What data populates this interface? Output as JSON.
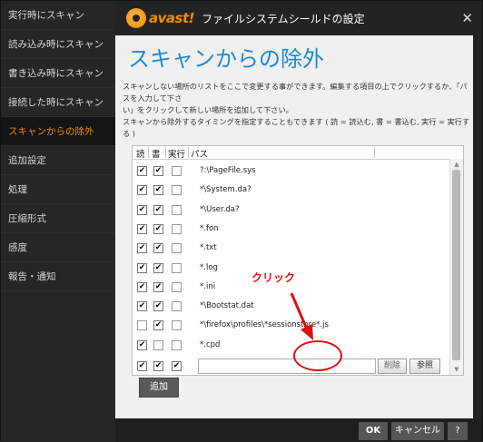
{
  "window": {
    "logo_text": "avast!",
    "title": "ファイルシステムシールドの設定",
    "close_glyph": "✕"
  },
  "sidebar": {
    "items": [
      {
        "label": "実行時にスキャン",
        "active": false
      },
      {
        "label": "読み込み時にスキャン",
        "active": false
      },
      {
        "label": "書き込み時にスキャン",
        "active": false
      },
      {
        "label": "接続した時にスキャン",
        "active": false
      },
      {
        "label": "スキャンからの除外",
        "active": true
      },
      {
        "label": "追加設定",
        "active": false
      },
      {
        "label": "処理",
        "active": false
      },
      {
        "label": "圧縮形式",
        "active": false
      },
      {
        "label": "感度",
        "active": false
      },
      {
        "label": "報告・通知",
        "active": false
      }
    ]
  },
  "main": {
    "heading": "スキャンからの除外",
    "description_line1": "スキャンしない場所のリストをここで変更する事ができます。編集する項目の上でクリックするか、「パスを入力して下さ",
    "description_line2": "い」をクリックして新しい場所を追加して下さい。",
    "description_line3": "スキャンから除外するタイミングを指定することもできます ( 読 = 読込む, 書 = 書込む, 実行 = 実行する )"
  },
  "table": {
    "headers": {
      "read": "読",
      "write": "書",
      "exec": "実行",
      "path": "パス"
    },
    "rows": [
      {
        "read": true,
        "write": true,
        "exec": false,
        "path": "?:\\PageFile.sys"
      },
      {
        "read": true,
        "write": true,
        "exec": false,
        "path": "*\\System.da?"
      },
      {
        "read": true,
        "write": true,
        "exec": false,
        "path": "*\\User.da?"
      },
      {
        "read": true,
        "write": true,
        "exec": false,
        "path": "*.fon"
      },
      {
        "read": true,
        "write": true,
        "exec": false,
        "path": "*.txt"
      },
      {
        "read": true,
        "write": true,
        "exec": false,
        "path": "*.log"
      },
      {
        "read": true,
        "write": true,
        "exec": false,
        "path": "*.ini"
      },
      {
        "read": true,
        "write": true,
        "exec": false,
        "path": "*\\Bootstat.dat"
      },
      {
        "read": false,
        "write": true,
        "exec": false,
        "path": "*\\firefox\\profiles\\*sessionstore*.js"
      },
      {
        "read": true,
        "write": false,
        "exec": false,
        "path": "*.cpd"
      }
    ],
    "new_row": {
      "read": true,
      "write": true,
      "exec": true,
      "path_value": ""
    },
    "delete_label": "削除",
    "browse_label": "参照",
    "check_glyph": "✔"
  },
  "annotation": {
    "text": "クリック",
    "color": "#e01010"
  },
  "add_button": "追加",
  "footer": {
    "ok": "OK",
    "cancel": "キャンセル",
    "help": "?"
  },
  "colors": {
    "accent": "#f28c00",
    "heading": "#1d8ad1"
  }
}
